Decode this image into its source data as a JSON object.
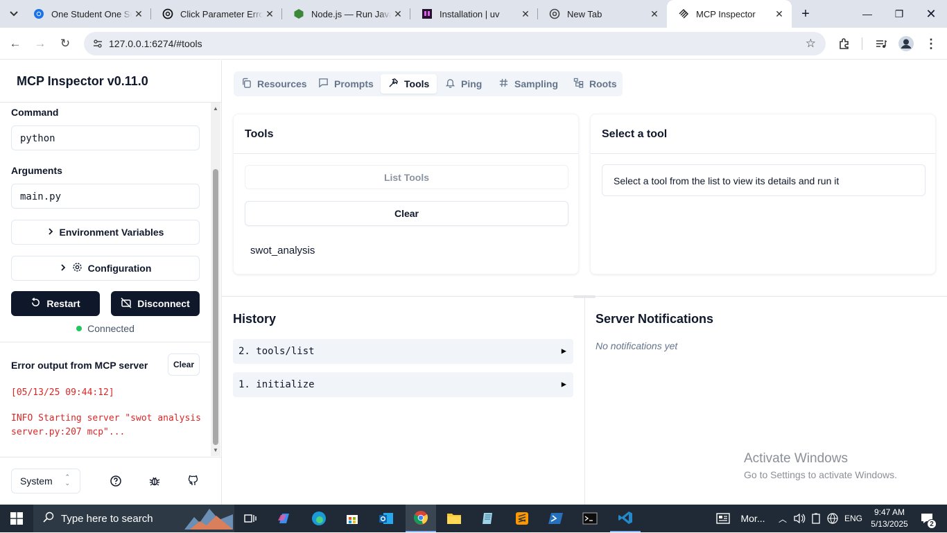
{
  "browser": {
    "tabs": [
      {
        "title": "One Student One Sub",
        "icon": "chrome-icon"
      },
      {
        "title": "Click Parameter Error",
        "icon": "openai-icon"
      },
      {
        "title": "Node.js — Run JavaScript",
        "icon": "nodejs-icon"
      },
      {
        "title": "Installation | uv",
        "icon": "uv-icon"
      },
      {
        "title": "New Tab",
        "icon": "chrome-icon"
      },
      {
        "title": "MCP Inspector",
        "icon": "mcp-icon",
        "active": true
      }
    ],
    "url": "127.0.0.1:6274/#tools"
  },
  "sidebar": {
    "title": "MCP Inspector v0.11.0",
    "command_label": "Command",
    "command_value": "python",
    "arguments_label": "Arguments",
    "arguments_value": "main.py",
    "env_button": "Environment Variables",
    "config_button": "Configuration",
    "restart_button": "Restart",
    "disconnect_button": "Disconnect",
    "status": "Connected",
    "status_color": "#22c55e",
    "error_title": "Error output from MCP server",
    "error_clear": "Clear",
    "error_lines": [
      "[05/13/25 09:44:12]",
      "INFO Starting server \"swot analysis",
      "server.py:207 mcp\"..."
    ],
    "theme_value": "System"
  },
  "main": {
    "tabs": [
      "Resources",
      "Prompts",
      "Tools",
      "Ping",
      "Sampling",
      "Roots"
    ],
    "active_tab": "Tools",
    "tools_card": {
      "title": "Tools",
      "list_button": "List Tools",
      "clear_button": "Clear",
      "items": [
        "swot_analysis"
      ]
    },
    "select_card": {
      "title": "Select a tool",
      "message": "Select a tool from the list to view its details and run it"
    },
    "history": {
      "title": "History",
      "items": [
        "2. tools/list",
        "1. initialize"
      ]
    },
    "notifications": {
      "title": "Server Notifications",
      "empty": "No notifications yet"
    },
    "watermark": {
      "line1": "Activate Windows",
      "line2": "Go to Settings to activate Windows."
    }
  },
  "taskbar": {
    "search_placeholder": "Type here to search",
    "running_app": "Mor...",
    "language": "ENG",
    "time": "9:47 AM",
    "date": "5/13/2025",
    "notification_count": "2"
  },
  "colors": {
    "primary": "#0f172a",
    "error": "#dc2626",
    "taskbar": "#1f2a36"
  }
}
